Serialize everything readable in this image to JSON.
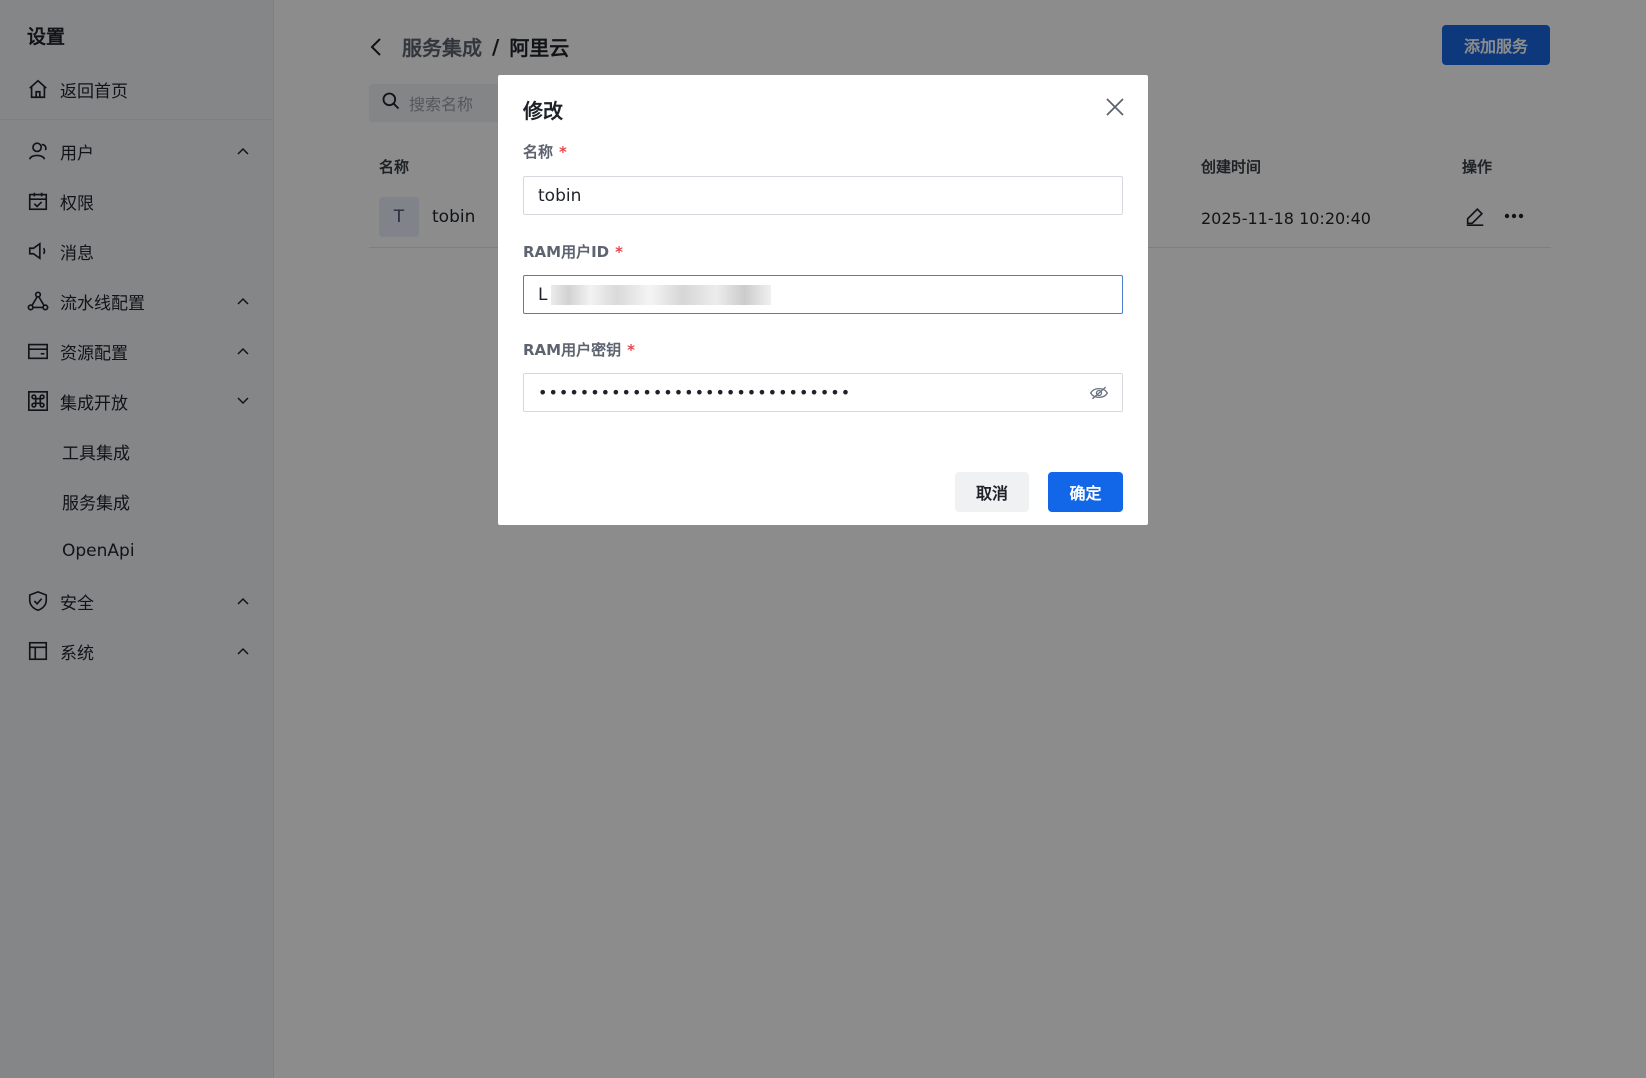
{
  "sidebar": {
    "title": "设置",
    "home_label": "返回首页",
    "items": [
      {
        "label": "用户"
      },
      {
        "label": "权限"
      },
      {
        "label": "消息"
      },
      {
        "label": "流水线配置"
      },
      {
        "label": "资源配置"
      },
      {
        "label": "集成开放"
      },
      {
        "label": "工具集成"
      },
      {
        "label": "服务集成"
      },
      {
        "label": "OpenApi"
      },
      {
        "label": "安全"
      },
      {
        "label": "系统"
      }
    ]
  },
  "header": {
    "breadcrumb_parent": "服务集成",
    "breadcrumb_separator": "/",
    "breadcrumb_current": "阿里云",
    "add_button": "添加服务"
  },
  "search": {
    "placeholder": "搜索名称"
  },
  "table": {
    "columns": {
      "name": "名称",
      "created_at": "创建时间",
      "actions": "操作"
    },
    "rows": [
      {
        "avatar": "T",
        "name": "tobin",
        "created_at": "2025-11-18 10:20:40"
      }
    ]
  },
  "modal": {
    "title": "修改",
    "fields": {
      "name": {
        "label": "名称",
        "required_mark": "*",
        "value": "tobin"
      },
      "ram_user_id": {
        "label": "RAM用户ID",
        "required_mark": "*",
        "value_prefix": "L"
      },
      "ram_user_secret": {
        "label": "RAM用户密钥",
        "required_mark": "*",
        "value": "••••••••••••••••••••••••••••••"
      }
    },
    "cancel_button": "取消",
    "confirm_button": "确定"
  },
  "colors": {
    "primary": "#1266e8",
    "required": "#e5484d",
    "sidebar_bg": "#f3f5f8"
  }
}
